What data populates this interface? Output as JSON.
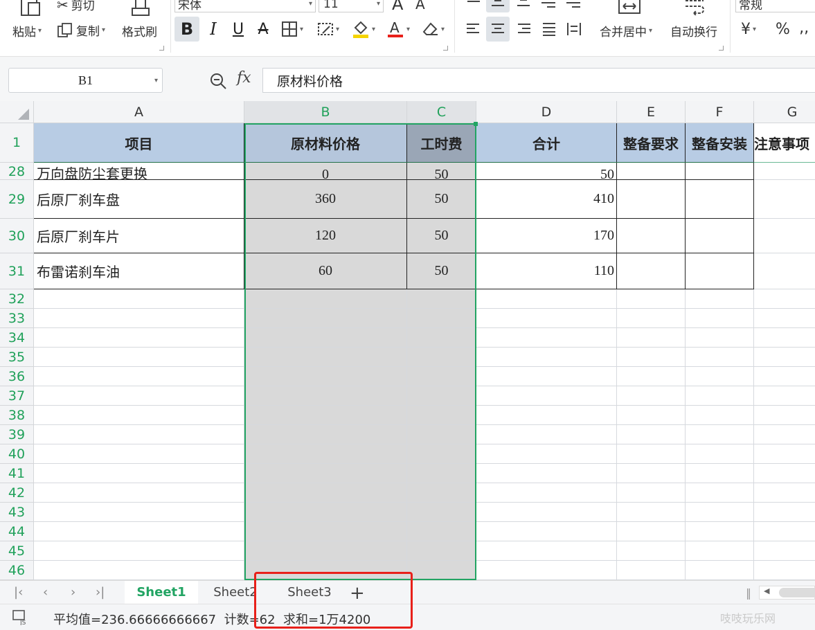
{
  "ribbon": {
    "paste": "粘贴",
    "cut": "剪切",
    "copy": "复制",
    "format_painter": "格式刷",
    "font_name": "宋体",
    "font_size": "11",
    "merge_center": "合并居中",
    "wrap_text": "自动换行",
    "number_format": "常规",
    "currency_symbol": "¥",
    "percent_symbol": "%",
    "accent_color": "#22a463",
    "font_color": "#e8201a",
    "fill_color": "#f5d400"
  },
  "formula_bar": {
    "name_box": "B1",
    "fx": "fx",
    "formula": "原材料价格"
  },
  "columns": [
    "A",
    "B",
    "C",
    "D",
    "E",
    "F",
    "G"
  ],
  "header_row": {
    "row_num": "1",
    "cells": [
      "项目",
      "原材料价格",
      "工时费",
      "合计",
      "整备要求",
      "整备安装",
      "注意事项"
    ]
  },
  "rows": [
    {
      "num": "28",
      "cells": [
        "万向盘防尘套更换",
        "0",
        "50",
        "50",
        "",
        "",
        ""
      ]
    },
    {
      "num": "29",
      "cells": [
        "后原厂刹车盘",
        "360",
        "50",
        "410",
        "",
        "",
        ""
      ]
    },
    {
      "num": "30",
      "cells": [
        "后原厂刹车片",
        "120",
        "50",
        "170",
        "",
        "",
        ""
      ]
    },
    {
      "num": "31",
      "cells": [
        "布雷诺刹车油",
        "60",
        "50",
        "110",
        "",
        "",
        ""
      ]
    }
  ],
  "empty_rows": [
    "32",
    "33",
    "34",
    "35",
    "36",
    "37",
    "38",
    "39",
    "40",
    "41",
    "42",
    "43",
    "44",
    "45",
    "46"
  ],
  "sheets": {
    "tabs": [
      "Sheet1",
      "Sheet2",
      "Sheet3"
    ],
    "active": "Sheet1",
    "add": "+"
  },
  "status": {
    "text": "平均值=236.66666666667  计数=62  求和=1万4200"
  },
  "watermark": "吱吱玩乐网"
}
